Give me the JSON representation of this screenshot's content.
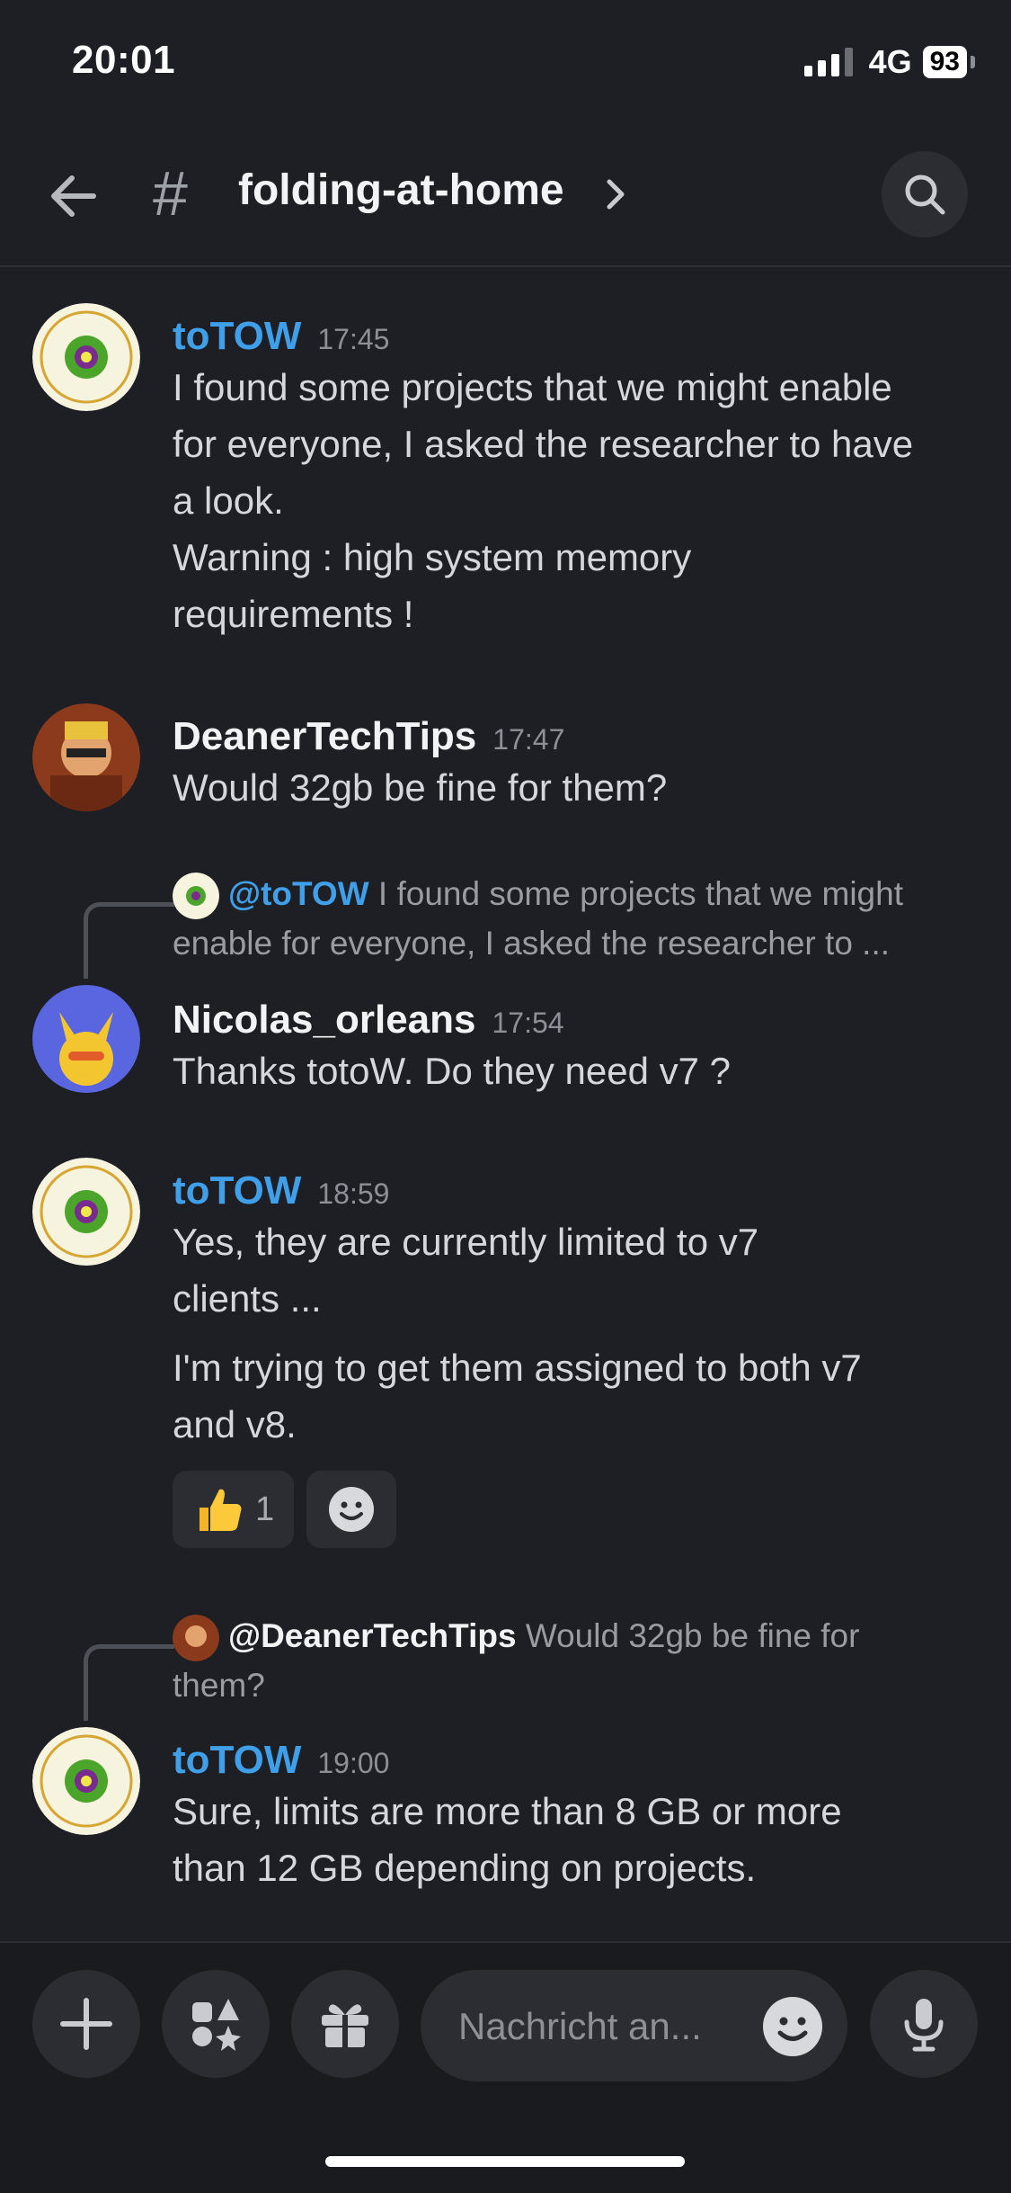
{
  "status_bar": {
    "time": "20:01",
    "network": "4G",
    "battery": "93"
  },
  "header": {
    "channel_hash": "#",
    "channel_name": "folding-at-home"
  },
  "messages": [
    {
      "author": "toTOW",
      "time": "17:45",
      "lines": [
        "I found some projects that we might enable",
        "for everyone, I asked the researcher to have",
        "a look.",
        "Warning : high system memory",
        "requirements !"
      ]
    },
    {
      "author": "DeanerTechTips",
      "time": "17:47",
      "lines": [
        "Would 32gb be fine for them?"
      ]
    },
    {
      "reply_mention": "@toTOW",
      "reply_line1": "I found some projects that we might",
      "reply_line2": "enable for everyone, I asked the researcher to ...",
      "author": "Nicolas_orleans",
      "time": "17:54",
      "lines": [
        "Thanks totoW. Do they need v7 ?"
      ]
    },
    {
      "author": "toTOW",
      "time": "18:59",
      "lines": [
        "Yes, they are currently limited to v7",
        "clients ..."
      ],
      "lines2": [
        "I'm trying to get them assigned to both v7",
        "and v8."
      ],
      "reaction_count": "1"
    },
    {
      "reply_mention": "@DeanerTechTips",
      "reply_line1": "Would 32gb be fine for",
      "reply_line2": "them?",
      "author": "toTOW",
      "time": "19:00",
      "lines": [
        "Sure, limits are more than 8 GB or more",
        "than 12 GB depending on projects."
      ]
    }
  ],
  "composer": {
    "placeholder": "Nachricht an..."
  },
  "icons": [
    "back-arrow-icon",
    "search-icon",
    "chevron-right-icon",
    "plus-icon",
    "apps-icon",
    "gift-icon",
    "emoji-icon",
    "mic-icon",
    "thumbs-up-icon"
  ],
  "colors": {
    "background": "#1e1f24",
    "link_blue": "#3f9fe8",
    "bubble": "#2b2d32"
  }
}
